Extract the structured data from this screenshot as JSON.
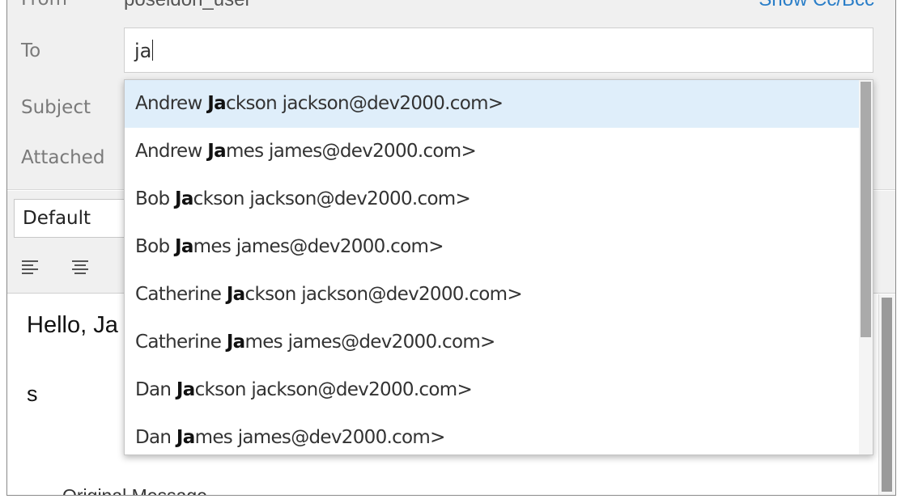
{
  "header": {
    "from_label": "From",
    "from_value": "poseidon_user",
    "show_cc_bcc": "Show Cc/Bcc",
    "to_label": "To",
    "to_value": "ja",
    "subject_label": "Subject",
    "attached_label": "Attached"
  },
  "toolbar": {
    "format_select": "Default",
    "icons": [
      "align-left-icon",
      "align-center-icon"
    ]
  },
  "body": {
    "greeting": "Hello, Ja",
    "signature": "s",
    "original_message": "Original Message"
  },
  "autocomplete": {
    "items": [
      {
        "first": "Andrew",
        "match": "Ja",
        "rest": "ckson",
        "email": "jackson@dev2000.com>"
      },
      {
        "first": "Andrew",
        "match": "Ja",
        "rest": "mes",
        "email": "james@dev2000.com>"
      },
      {
        "first": "Bob",
        "match": "Ja",
        "rest": "ckson",
        "email": "jackson@dev2000.com>"
      },
      {
        "first": "Bob",
        "match": "Ja",
        "rest": "mes",
        "email": "james@dev2000.com>"
      },
      {
        "first": "Catherine",
        "match": "Ja",
        "rest": "ckson",
        "email": "jackson@dev2000.com>"
      },
      {
        "first": "Catherine",
        "match": "Ja",
        "rest": "mes",
        "email": "james@dev2000.com>"
      },
      {
        "first": "Dan",
        "match": "Ja",
        "rest": "ckson",
        "email": "jackson@dev2000.com>"
      },
      {
        "first": "Dan",
        "match": "Ja",
        "rest": "mes",
        "email": "james@dev2000.com>"
      }
    ]
  },
  "colors": {
    "highlight": "#dfeefa",
    "link": "#2a7ec8",
    "header_bg": "#f0f0f0"
  }
}
